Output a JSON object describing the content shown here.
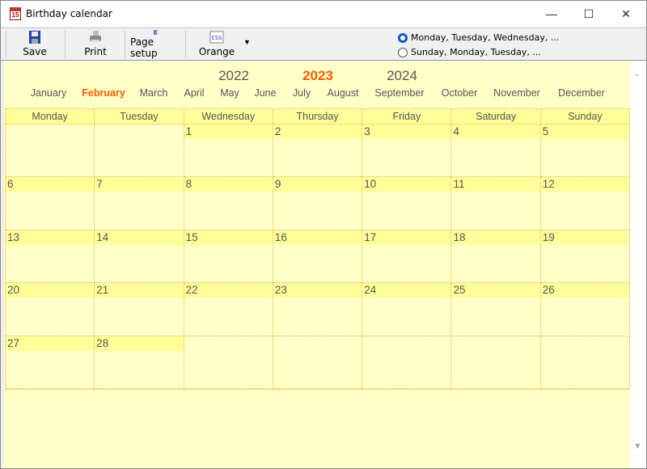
{
  "window": {
    "title": "Birthday calendar",
    "app_icon_text": "15"
  },
  "toolbar": {
    "save": "Save",
    "print": "Print",
    "page_setup": "Page setup",
    "style": "Orange"
  },
  "week_start": {
    "options": [
      "Monday, Tuesday, Wednesday, ...",
      "Sunday, Monday, Tuesday, ..."
    ],
    "selected": 0
  },
  "years": [
    "2022",
    "2023",
    "2024"
  ],
  "selected_year": "2023",
  "months": [
    "January",
    "February",
    "March",
    "April",
    "May",
    "June",
    "July",
    "August",
    "September",
    "October",
    "November",
    "December"
  ],
  "selected_month": "February",
  "weekdays": [
    "Monday",
    "Tuesday",
    "Wednesday",
    "Thursday",
    "Friday",
    "Saturday",
    "Sunday"
  ],
  "weeks": [
    [
      "",
      "",
      "1",
      "2",
      "3",
      "4",
      "5"
    ],
    [
      "6",
      "7",
      "8",
      "9",
      "10",
      "11",
      "12"
    ],
    [
      "13",
      "14",
      "15",
      "16",
      "17",
      "18",
      "19"
    ],
    [
      "20",
      "21",
      "22",
      "23",
      "24",
      "25",
      "26"
    ],
    [
      "27",
      "28",
      "",
      "",
      "",
      "",
      ""
    ]
  ],
  "colors": {
    "accent": "#ff5a00",
    "background": "#ffffc8",
    "band": "#ffff99",
    "border": "#f0b040"
  }
}
